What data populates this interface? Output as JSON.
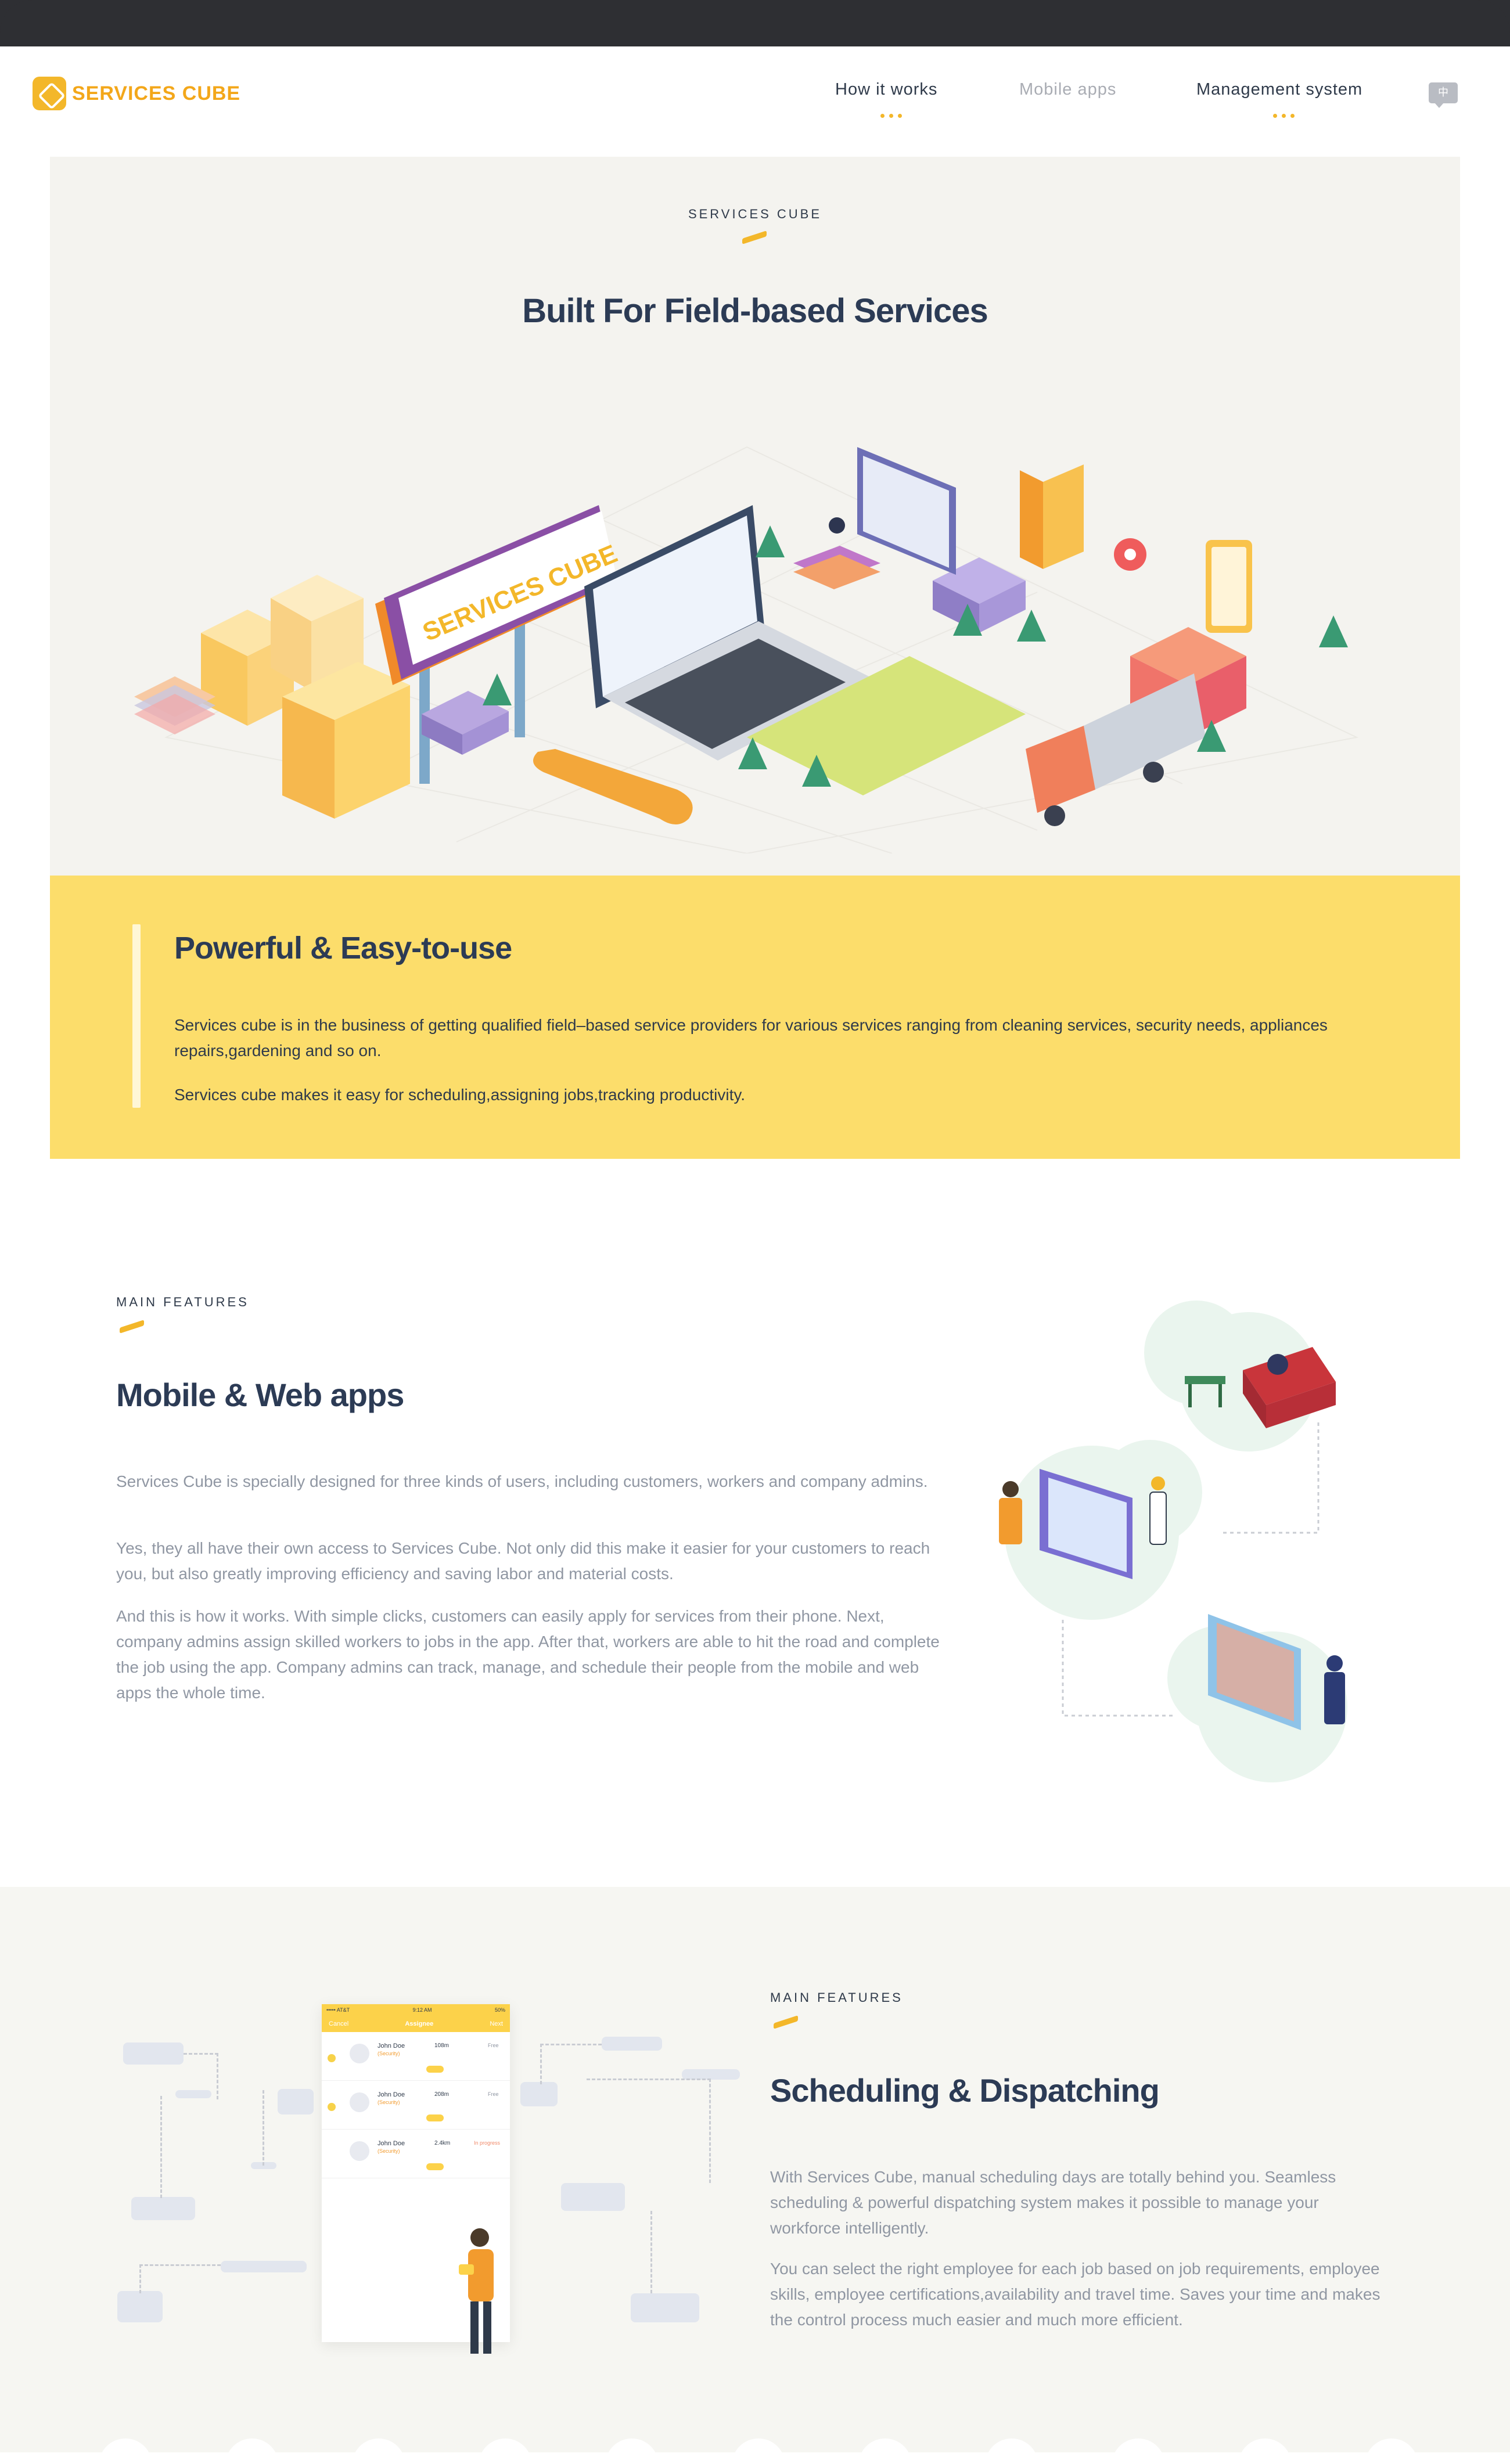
{
  "brand": {
    "logo_text": "SERVICES CUBE",
    "accent": "#f3b72a",
    "dark": "#2c3b55"
  },
  "nav": {
    "items": [
      {
        "label": "How it works",
        "active": true
      },
      {
        "label": "Mobile apps",
        "active": false
      },
      {
        "label": "Management system",
        "active": true
      }
    ],
    "lang_label": "中"
  },
  "hero": {
    "eyebrow": "SERVICES CUBE",
    "title": "Built For Field-based Services",
    "billboard_text": "SERVICES CUBE"
  },
  "intro": {
    "title": "Powerful & Easy-to-use",
    "p1": "Services cube is in the business of getting qualified field–based service providers for various services ranging from cleaning services, security needs, appliances repairs,gardening and so on.",
    "p2": "Services cube makes it easy for scheduling,assigning jobs,tracking productivity."
  },
  "feature1": {
    "eyebrow": "MAIN FEATURES",
    "title": "Mobile & Web apps",
    "p1": "Services Cube is specially designed for three kinds of users, including customers, workers and company admins.",
    "p2": "Yes, they all have their own access to Services Cube. Not only did this make it easier for your customers to reach you, but also greatly improving efficiency and saving labor and material costs.",
    "p3": "And this is how it works. With simple clicks, customers can easily apply for services from their phone. Next, company admins assign skilled workers to jobs in the app. After that, workers are able to hit the road and complete the job using the app. Company admins can track, manage, and schedule their people from the mobile and web apps the whole time."
  },
  "feature2": {
    "eyebrow": "MAIN FEATURES",
    "title": "Scheduling & Dispatching",
    "p1": "With Services Cube, manual scheduling days are totally behind you. Seamless scheduling & powerful dispatching system makes it possible to manage your workforce intelligently.",
    "p2": "You can select the right employee for each job based on job requirements, employee skills, employee certifications,availability and travel time. Saves your time and makes the control process much easier and much more efficient."
  },
  "phone": {
    "status_left": "••••• AT&T",
    "status_time": "9:12 AM",
    "status_right": "50%",
    "cancel": "Cancel",
    "tab_title": "Assignee",
    "next": "Next",
    "rows": [
      {
        "name": "John Doe",
        "role": "(Security)",
        "dist": "108m",
        "status": "Free"
      },
      {
        "name": "John Doe",
        "role": "(Security)",
        "dist": "208m",
        "status": "Free"
      },
      {
        "name": "John Doe",
        "role": "(Security)",
        "dist": "2.4km",
        "status": "In progress"
      }
    ]
  }
}
